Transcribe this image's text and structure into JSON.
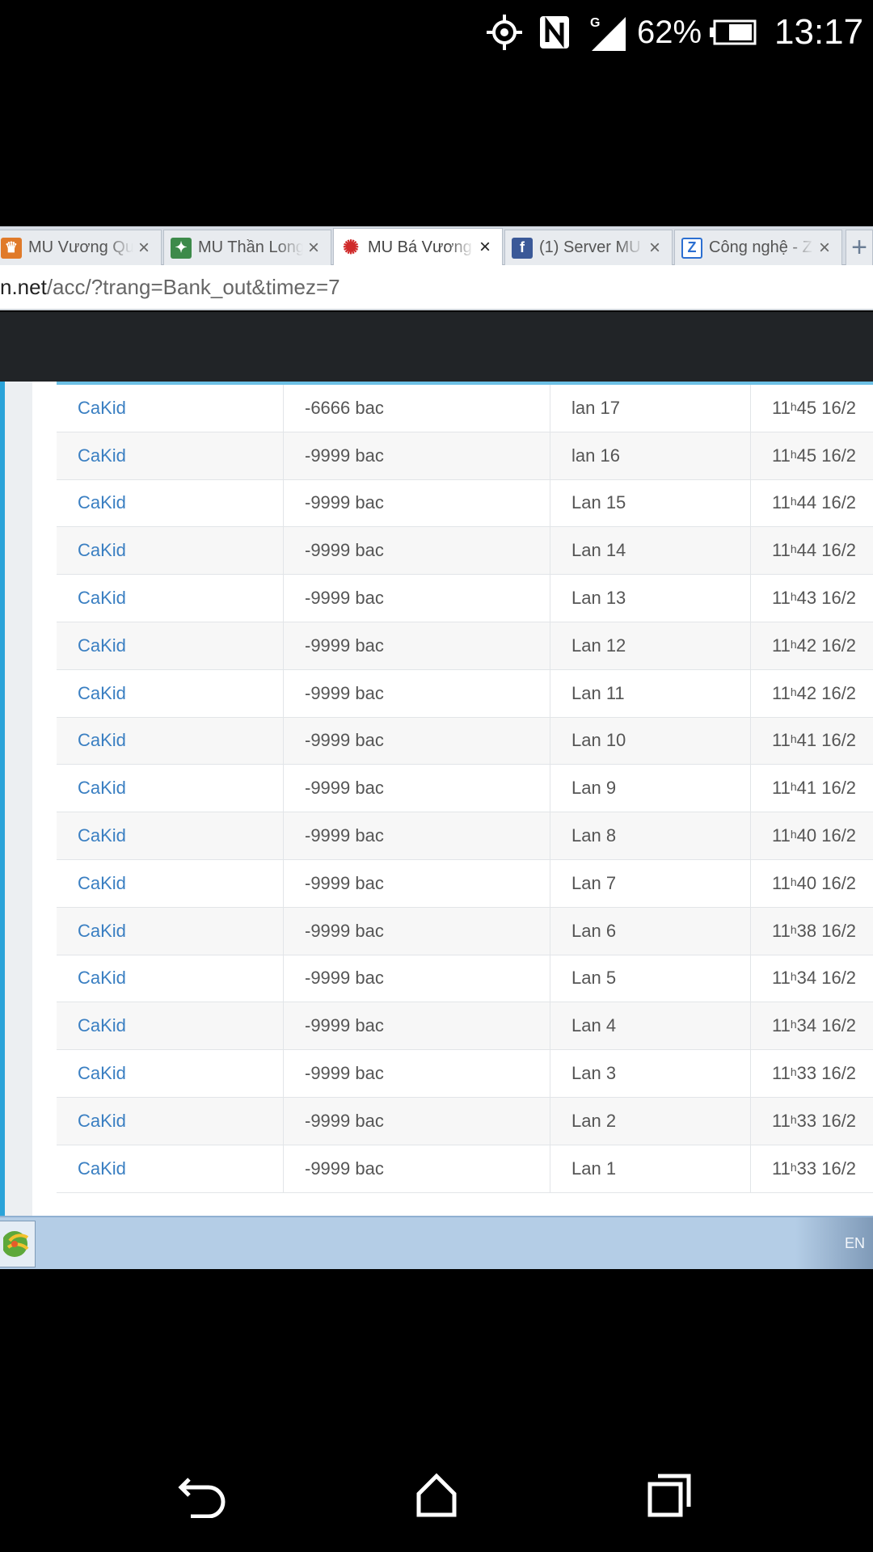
{
  "status_bar": {
    "battery": "62%",
    "time": "13:17",
    "network_type": "G",
    "icons": [
      "gps-icon",
      "nfc-icon",
      "signal-icon",
      "battery-icon"
    ]
  },
  "browser": {
    "tabs": [
      {
        "title": "MU Vương Quốc",
        "icon": "mu-crown-icon",
        "active": false
      },
      {
        "title": "MU Thần Long",
        "icon": "mu-dragon-icon",
        "active": false
      },
      {
        "title": "MU Bá Vương",
        "icon": "mu-swirl-icon",
        "active": true
      },
      {
        "title": "(1) Server MU",
        "icon": "facebook-icon",
        "active": false
      },
      {
        "title": "Công nghệ - Z",
        "icon": "zing-icon",
        "active": false
      }
    ],
    "close_glyph": "×",
    "new_tab_glyph": "+",
    "url_host": "n.net",
    "url_path": "/acc/?trang=Bank_out&timez=7"
  },
  "bank_log": {
    "rows": [
      {
        "user": "CaKid",
        "amount": "-6666  bac",
        "lan": "lan 17",
        "hour": "11",
        "sup": "h",
        "rest": "45 16/2"
      },
      {
        "user": "CaKid",
        "amount": "-9999  bac",
        "lan": "lan 16",
        "hour": "11",
        "sup": "h",
        "rest": "45 16/2"
      },
      {
        "user": "CaKid",
        "amount": "-9999  bac",
        "lan": "Lan 15",
        "hour": "11",
        "sup": "h",
        "rest": "44 16/2"
      },
      {
        "user": "CaKid",
        "amount": "-9999  bac",
        "lan": "Lan 14",
        "hour": "11",
        "sup": "h",
        "rest": "44 16/2"
      },
      {
        "user": "CaKid",
        "amount": "-9999  bac",
        "lan": "Lan 13",
        "hour": "11",
        "sup": "h",
        "rest": "43 16/2"
      },
      {
        "user": "CaKid",
        "amount": "-9999  bac",
        "lan": "Lan 12",
        "hour": "11",
        "sup": "h",
        "rest": "42 16/2"
      },
      {
        "user": "CaKid",
        "amount": "-9999  bac",
        "lan": "Lan 11",
        "hour": "11",
        "sup": "h",
        "rest": "42 16/2"
      },
      {
        "user": "CaKid",
        "amount": "-9999  bac",
        "lan": "Lan 10",
        "hour": "11",
        "sup": "h",
        "rest": "41 16/2"
      },
      {
        "user": "CaKid",
        "amount": "-9999  bac",
        "lan": "Lan 9",
        "hour": "11",
        "sup": "h",
        "rest": "41 16/2"
      },
      {
        "user": "CaKid",
        "amount": "-9999  bac",
        "lan": "Lan 8",
        "hour": "11",
        "sup": "h",
        "rest": "40 16/2"
      },
      {
        "user": "CaKid",
        "amount": "-9999  bac",
        "lan": "Lan 7",
        "hour": "11",
        "sup": "h",
        "rest": "40 16/2"
      },
      {
        "user": "CaKid",
        "amount": "-9999  bac",
        "lan": "Lan 6",
        "hour": "11",
        "sup": "h",
        "rest": "38 16/2"
      },
      {
        "user": "CaKid",
        "amount": "-9999  bac",
        "lan": "Lan 5",
        "hour": "11",
        "sup": "h",
        "rest": "34 16/2"
      },
      {
        "user": "CaKid",
        "amount": "-9999  bac",
        "lan": "Lan 4",
        "hour": "11",
        "sup": "h",
        "rest": "34 16/2"
      },
      {
        "user": "CaKid",
        "amount": "-9999  bac",
        "lan": "Lan 3",
        "hour": "11",
        "sup": "h",
        "rest": "33 16/2"
      },
      {
        "user": "CaKid",
        "amount": "-9999  bac",
        "lan": "Lan 2",
        "hour": "11",
        "sup": "h",
        "rest": "33 16/2"
      },
      {
        "user": "CaKid",
        "amount": "-9999  bac",
        "lan": "Lan 1",
        "hour": "11",
        "sup": "h",
        "rest": "33 16/2"
      }
    ]
  },
  "taskbar": {
    "language": "EN",
    "start_icon": "start-logo-icon"
  },
  "nav": {
    "icons": [
      "back-icon",
      "home-icon",
      "recent-apps-icon"
    ]
  },
  "colors": {
    "link": "#3a7fc2",
    "header_dark": "#212427",
    "accent_blue": "#2aa3d9",
    "taskbar": "#b4cde6"
  }
}
